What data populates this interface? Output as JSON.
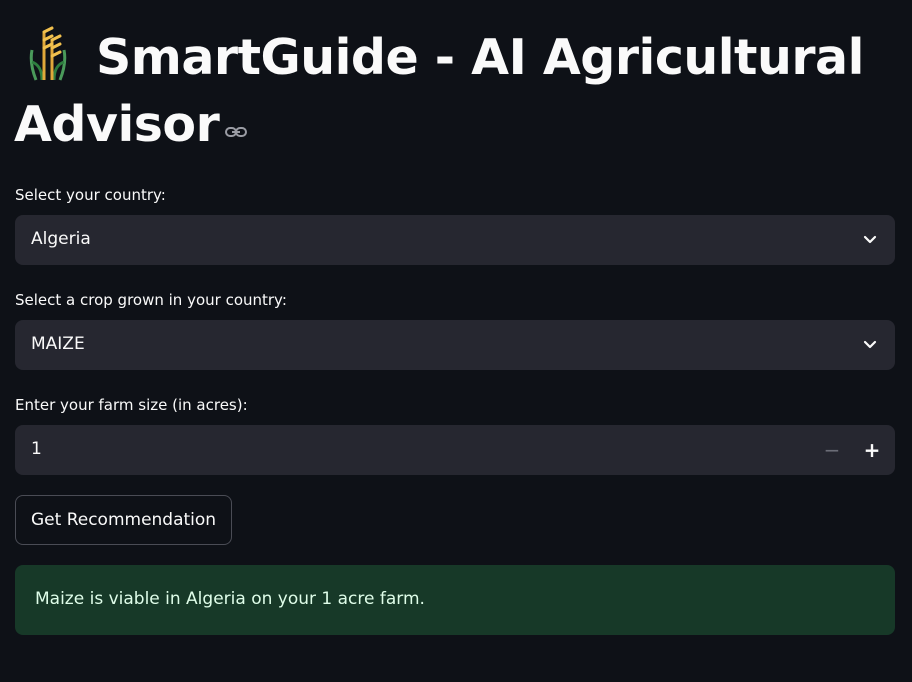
{
  "header": {
    "emoji_icon": "wheat-sheaf-icon",
    "title": "SmartGuide - AI Agricultural Advisor",
    "anchor_icon": "link-icon"
  },
  "form": {
    "country": {
      "label": "Select your country:",
      "value": "Algeria",
      "icon": "chevron-down-icon"
    },
    "crop": {
      "label": "Select a crop grown in your country:",
      "value": "MAIZE",
      "icon": "chevron-down-icon"
    },
    "farm_size": {
      "label": "Enter your farm size (in acres):",
      "value": "1",
      "decrement_label": "−",
      "increment_label": "+"
    },
    "submit_label": "Get Recommendation"
  },
  "result": {
    "message": "Maize is viable in Algeria on your 1 acre farm."
  },
  "colors": {
    "background": "#0e1117",
    "input_bg": "#262730",
    "success_bg": "#173928",
    "success_text": "#dffde9"
  }
}
